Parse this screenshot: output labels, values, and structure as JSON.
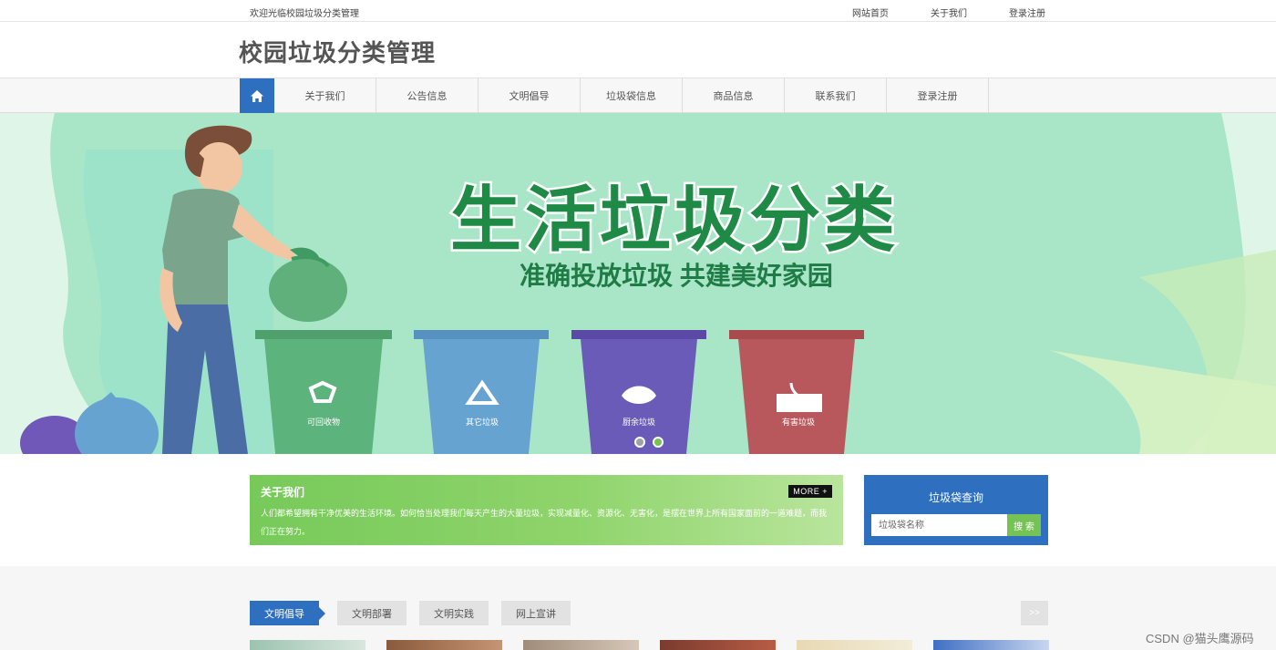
{
  "topbar": {
    "welcome": "欢迎光临校园垃圾分类管理",
    "links": [
      "网站首页",
      "关于我们",
      "登录注册"
    ]
  },
  "header": {
    "title": "校园垃圾分类管理"
  },
  "nav": {
    "home_icon": "home-icon",
    "items": [
      "关于我们",
      "公告信息",
      "文明倡导",
      "垃圾袋信息",
      "商品信息",
      "联系我们",
      "登录注册"
    ]
  },
  "banner": {
    "headline": "生活垃圾分类",
    "subline": "准确投放垃圾 共建美好家园",
    "bins": [
      "可回收物",
      "其它垃圾",
      "厨余垃圾",
      "有害垃圾"
    ],
    "bin_colors": [
      "#5cb37c",
      "#66a3d0",
      "#6b5bb8",
      "#b9585c"
    ],
    "slide_active": 2,
    "slide_count": 2
  },
  "about": {
    "title": "关于我们",
    "more": "MORE +",
    "text": "人们都希望拥有干净优美的生活环境。如何恰当处理我们每天产生的大量垃圾，实现减量化、资源化、无害化，是摆在世界上所有国家面前的一道难题，而我们正在努力。"
  },
  "search": {
    "title": "垃圾袋查询",
    "placeholder": "垃圾袋名称",
    "button": "搜 索"
  },
  "tabs": {
    "items": [
      "文明倡导",
      "文明部署",
      "文明实践",
      "网上宣讲"
    ],
    "next": ">>"
  },
  "watermark": "CSDN @猫头鹰源码",
  "colors": {
    "primary": "#2f6fbf",
    "green": "#76c355",
    "banner_bg": "#cdeedb"
  }
}
